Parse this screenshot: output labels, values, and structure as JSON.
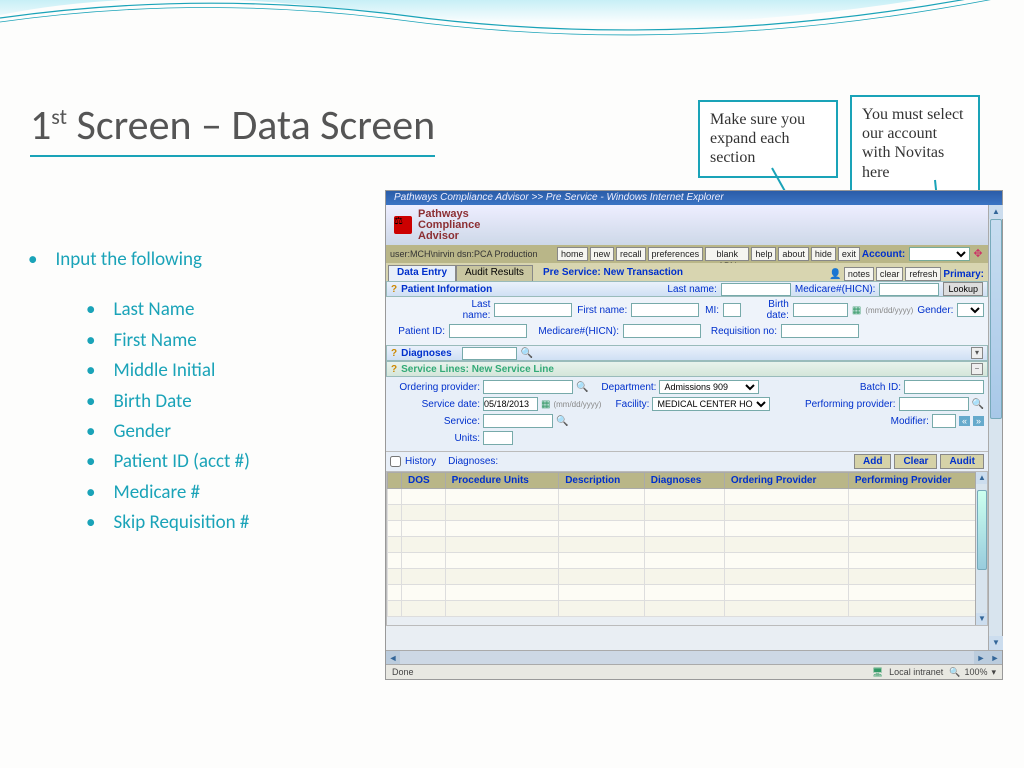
{
  "slide": {
    "title_pre": "1",
    "title_sup": "st",
    "title_rest": " Screen – Data Screen"
  },
  "callouts": {
    "c1": "Make sure you expand each section",
    "c2": "You must select our account with Novitas here"
  },
  "instructions": {
    "lead": "Input the following",
    "items": [
      "Last Name",
      "First Name",
      "Middle Initial",
      "Birth Date",
      "Gender",
      "Patient ID (acct #)",
      "Medicare #",
      "Skip Requisition #"
    ]
  },
  "app": {
    "window_title": "Pathways Compliance Advisor >> Pre Service - Windows Internet Explorer",
    "logo_line1": "Pathways",
    "logo_line2": "Compliance",
    "logo_line3": "Advisor",
    "user_dsn": "user:MCH\\nirvin dsn:PCA Production",
    "toolbar": [
      "home",
      "new",
      "recall",
      "preferences",
      "blank ABN",
      "help",
      "about",
      "hide",
      "exit"
    ],
    "account_label": "Account:",
    "tabs": {
      "t1": "Data Entry",
      "t2": "Audit Results"
    },
    "subtitle": "Pre Service: New Transaction",
    "top_btns": [
      "notes",
      "clear",
      "refresh"
    ],
    "primary_label": "Primary:",
    "patient_info": {
      "header": "Patient Information",
      "last_name_hdr": "Last name:",
      "medicare_hdr": "Medicare#(HICN):",
      "lookup": "Lookup",
      "labels": {
        "last_name": "Last name:",
        "first_name": "First name:",
        "mi": "MI:",
        "birth": "Birth date:",
        "birth_hint": "(mm/dd/yyyy)",
        "gender": "Gender:",
        "patient_id": "Patient ID:",
        "medicare": "Medicare#(HICN):",
        "req": "Requisition no:"
      }
    },
    "diagnoses": {
      "header": "Diagnoses"
    },
    "service_lines": {
      "header": "Service Lines: New Service Line",
      "labels": {
        "ordering": "Ordering provider:",
        "dept": "Department:",
        "batch": "Batch ID:",
        "svc_date": "Service date:",
        "date_hint": "(mm/dd/yyyy)",
        "facility": "Facility:",
        "performing": "Performing  provider:",
        "service": "Service:",
        "modifier": "Modifier:",
        "units": "Units:"
      },
      "values": {
        "svc_date": "05/18/2013",
        "dept": "Admissions 909",
        "facility": "MEDICAL CENTER HOSPI"
      },
      "history": "History",
      "diagnoses_label": "Diagnoses:",
      "actions": [
        "Add",
        "Clear",
        "Audit"
      ]
    },
    "grid_headers": [
      "DOS",
      "Procedure Units",
      "Description",
      "Diagnoses",
      "Ordering Provider",
      "Performing Provider"
    ],
    "status": {
      "done": "Done",
      "zone": "Local intranet",
      "zoom": "100%"
    }
  }
}
